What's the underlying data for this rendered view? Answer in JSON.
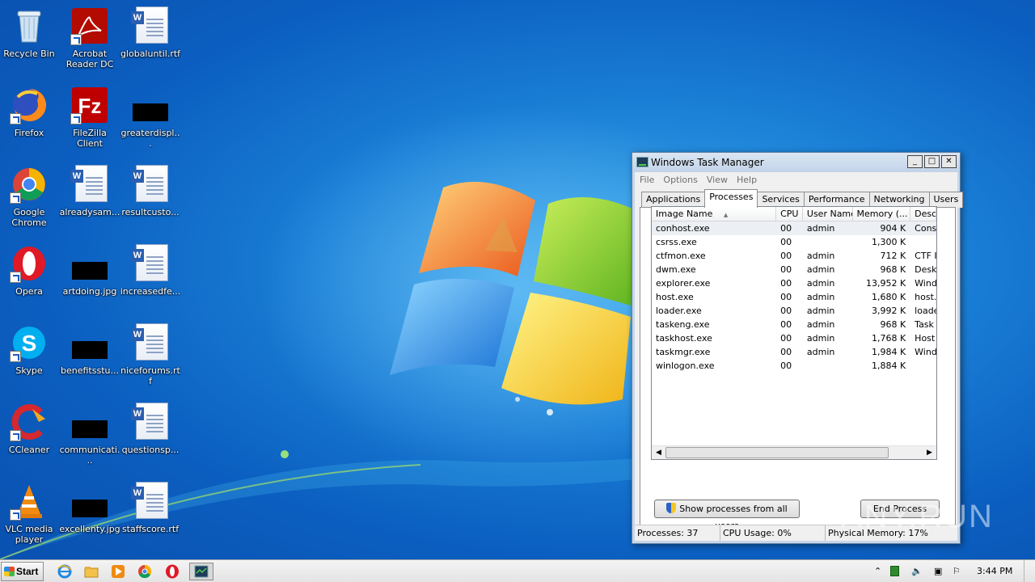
{
  "desktop": {
    "icons": [
      {
        "label": "Recycle Bin"
      },
      {
        "label": "Acrobat Reader DC"
      },
      {
        "label": "globaluntil.rtf"
      },
      {
        "label": "Firefox"
      },
      {
        "label": "FileZilla Client"
      },
      {
        "label": "greaterdispl..."
      },
      {
        "label": "Google Chrome"
      },
      {
        "label": "alreadysam..."
      },
      {
        "label": "resultcusto..."
      },
      {
        "label": "Opera"
      },
      {
        "label": "artdoing.jpg"
      },
      {
        "label": "increasedfe..."
      },
      {
        "label": "Skype"
      },
      {
        "label": "benefitsstu..."
      },
      {
        "label": "niceforums.rtf"
      },
      {
        "label": "CCleaner"
      },
      {
        "label": "communicati..."
      },
      {
        "label": "questionsp..."
      },
      {
        "label": "VLC media player"
      },
      {
        "label": "excellenty.jpg"
      },
      {
        "label": "staffscore.rtf"
      }
    ]
  },
  "taskmgr": {
    "title": "Windows Task Manager",
    "menu": [
      "File",
      "Options",
      "View",
      "Help"
    ],
    "tabs": [
      "Applications",
      "Processes",
      "Services",
      "Performance",
      "Networking",
      "Users"
    ],
    "active_tab": "Processes",
    "columns": [
      "Image Name",
      "CPU",
      "User Name",
      "Memory (...",
      "Desc"
    ],
    "sort_indicator": "▲",
    "rows": [
      {
        "name": "conhost.exe",
        "cpu": "00",
        "user": "admin",
        "mem": "904 K",
        "desc": "Cons"
      },
      {
        "name": "csrss.exe",
        "cpu": "00",
        "user": "",
        "mem": "1,300 K",
        "desc": ""
      },
      {
        "name": "ctfmon.exe",
        "cpu": "00",
        "user": "admin",
        "mem": "712 K",
        "desc": "CTF I"
      },
      {
        "name": "dwm.exe",
        "cpu": "00",
        "user": "admin",
        "mem": "968 K",
        "desc": "Desk"
      },
      {
        "name": "explorer.exe",
        "cpu": "00",
        "user": "admin",
        "mem": "13,952 K",
        "desc": "Wind"
      },
      {
        "name": "host.exe",
        "cpu": "00",
        "user": "admin",
        "mem": "1,680 K",
        "desc": "host."
      },
      {
        "name": "loader.exe",
        "cpu": "00",
        "user": "admin",
        "mem": "3,992 K",
        "desc": "loade"
      },
      {
        "name": "taskeng.exe",
        "cpu": "00",
        "user": "admin",
        "mem": "968 K",
        "desc": "Task"
      },
      {
        "name": "taskhost.exe",
        "cpu": "00",
        "user": "admin",
        "mem": "1,768 K",
        "desc": "Host"
      },
      {
        "name": "taskmgr.exe",
        "cpu": "00",
        "user": "admin",
        "mem": "1,984 K",
        "desc": "Wind"
      },
      {
        "name": "winlogon.exe",
        "cpu": "00",
        "user": "",
        "mem": "1,884 K",
        "desc": ""
      }
    ],
    "show_all_label": "Show processes from all users",
    "end_process_label": "End Process",
    "status": {
      "processes": "Processes: 37",
      "cpu": "CPU Usage: 0%",
      "memory": "Physical Memory: 17%"
    }
  },
  "taskbar": {
    "start_label": "Start",
    "clock": "3:44 PM",
    "pinned": [
      "internet-explorer-icon",
      "explorer-icon",
      "media-player-icon",
      "chrome-icon",
      "opera-icon",
      "task-manager-icon"
    ]
  },
  "watermark": "ANY.RUN",
  "colors": {
    "desktop_blue": "#1a7fd6",
    "window_frame": "#c7d6e8",
    "selection": "#eceff3"
  }
}
